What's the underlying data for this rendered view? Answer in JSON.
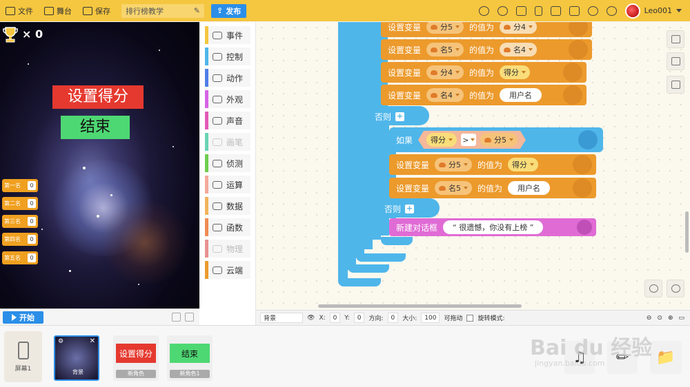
{
  "topbar": {
    "file_label": "文件",
    "stage_label": "舞台",
    "save_label": "保存",
    "project_name": "排行榜教学",
    "publish_label": "发布",
    "username": "Leo001"
  },
  "stage": {
    "lives": "× 0",
    "sprite_title": "设置得分",
    "sprite_end": "结束",
    "ranks": [
      {
        "label": "第一名",
        "value": "0"
      },
      {
        "label": "第二名",
        "value": "0"
      },
      {
        "label": "第三名",
        "value": "0"
      },
      {
        "label": "第四名",
        "value": "0"
      },
      {
        "label": "第五名",
        "value": "0"
      }
    ],
    "start_label": "开始"
  },
  "palette": {
    "categories": [
      {
        "label": "事件",
        "color": "#f5c63f",
        "disabled": false
      },
      {
        "label": "控制",
        "color": "#4fb6ea",
        "disabled": false
      },
      {
        "label": "动作",
        "color": "#4f7ee8",
        "disabled": false
      },
      {
        "label": "外观",
        "color": "#d763e6",
        "disabled": false
      },
      {
        "label": "声音",
        "color": "#e25bb5",
        "disabled": false
      },
      {
        "label": "画笔",
        "color": "#69d4b3",
        "disabled": true
      },
      {
        "label": "侦测",
        "color": "#6fce4e",
        "disabled": false
      },
      {
        "label": "运算",
        "color": "#f4a99a",
        "disabled": false
      },
      {
        "label": "数据",
        "color": "#f2b35c",
        "disabled": false
      },
      {
        "label": "函数",
        "color": "#f08b52",
        "disabled": false
      },
      {
        "label": "物理",
        "color": "#ea9191",
        "disabled": true
      },
      {
        "label": "云端",
        "color": "#ec9a2c",
        "disabled": false
      }
    ]
  },
  "code": {
    "set_var": "设置变量",
    "value_of": "的值为",
    "else_label": "否则",
    "if_label": "如果",
    "rows": [
      {
        "var": "分5",
        "val": "分4",
        "val_type": "var"
      },
      {
        "var": "名5",
        "val": "名4",
        "val_type": "var"
      },
      {
        "var": "分4",
        "val": "得分",
        "val_type": "num"
      },
      {
        "var": "名4",
        "val": "用户名",
        "val_type": "white"
      }
    ],
    "cond_left": "得分",
    "cond_op": ">",
    "cond_right": "分5",
    "inner_rows": [
      {
        "var": "分5",
        "val": "得分",
        "val_type": "num"
      },
      {
        "var": "名5",
        "val": "用户名",
        "val_type": "white"
      }
    ],
    "dialog_label": "新建对话框",
    "dialog_text": "“ 很遗憾，你没有上榜 ”"
  },
  "props": {
    "sprite_name": "背景",
    "x_label": "X:",
    "x_value": "0",
    "y_label": "Y:",
    "y_value": "0",
    "dir_label": "方向:",
    "dir_value": "0",
    "size_label": "大小:",
    "size_value": "100",
    "draggable_label": "可拖动",
    "rotate_label": "旋转模式:"
  },
  "bottom": {
    "screen_label": "屏幕1",
    "sprites": [
      {
        "label": "背景",
        "thumb": ""
      },
      {
        "label": "新角色",
        "thumb": "设置得分"
      },
      {
        "label": "新角色1",
        "thumb": "结束"
      }
    ]
  },
  "watermark": {
    "text": "Bai du 经验",
    "url": "jingyan.baidu.com"
  }
}
